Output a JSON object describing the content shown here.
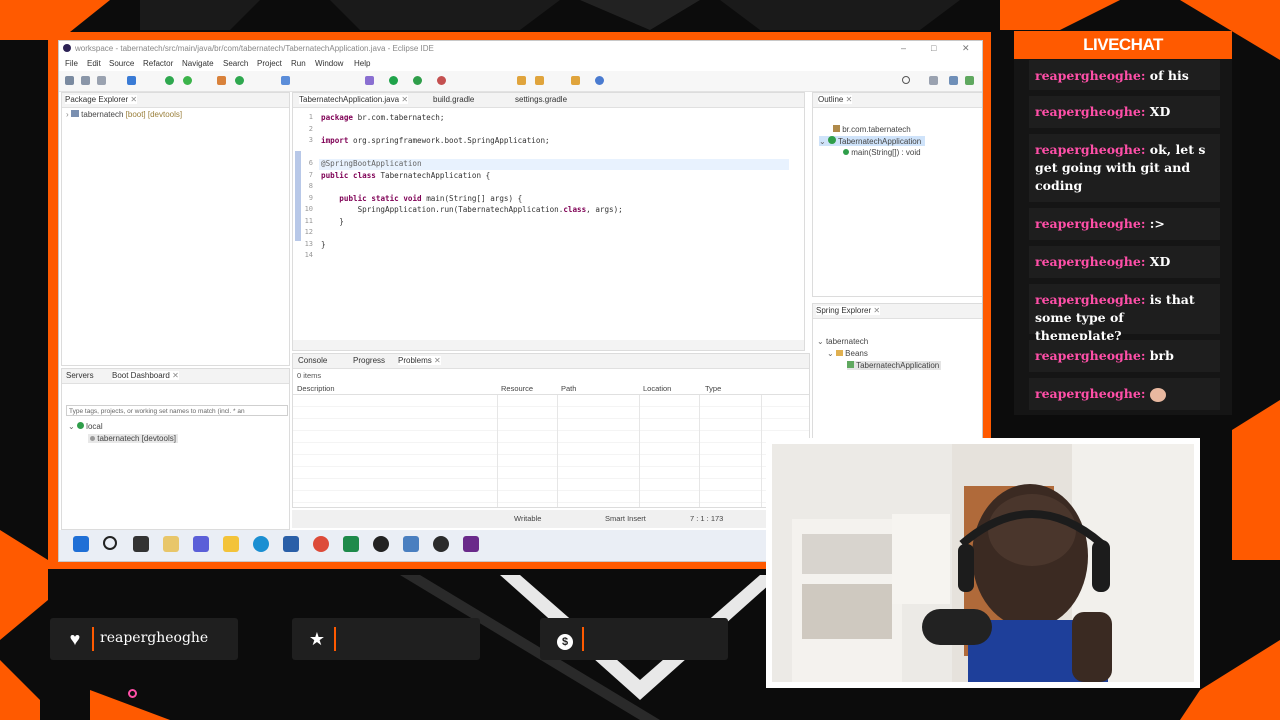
{
  "eclipse": {
    "window_title": "workspace - tabernatech/src/main/java/br/com/tabernatech/TabernatechApplication.java - Eclipse IDE",
    "menu": [
      "File",
      "Edit",
      "Source",
      "Refactor",
      "Navigate",
      "Search",
      "Project",
      "Run",
      "Window",
      "Help"
    ],
    "package_explorer": {
      "tab": "Package Explorer",
      "project": "tabernatech",
      "project_suffix": "[boot] [devtools]"
    },
    "editor": {
      "tabs": [
        "TabernatechApplication.java",
        "build.gradle",
        "settings.gradle"
      ],
      "line_numbers": [
        "1",
        "2",
        "3",
        "",
        "6",
        "7",
        "8",
        "9",
        "10",
        "11",
        "12",
        "13",
        "14"
      ],
      "lines": [
        "package br.com.tabernatech;",
        "",
        "import org.springframework.boot.SpringApplication;",
        "",
        "@SpringBootApplication",
        "public class TabernatechApplication {",
        "",
        "    public static void main(String[] args) {",
        "        SpringApplication.run(TabernatechApplication.class, args);",
        "    }",
        "",
        "}",
        ""
      ]
    },
    "outline": {
      "tab": "Outline",
      "items": [
        "br.com.tabernatech",
        "TabernatechApplication",
        "main(String[]) : void"
      ]
    },
    "spring_explorer": {
      "tab": "Spring Explorer",
      "items": [
        "tabernatech",
        "Beans",
        "TabernatechApplication"
      ]
    },
    "boot_dashboard": {
      "tabs": [
        "Servers",
        "Boot Dashboard"
      ],
      "filter_placeholder": "Type tags, projects, or working set names to match (incl. * an",
      "items": [
        "local",
        "tabernatech [devtools]"
      ]
    },
    "problems": {
      "tabs": [
        "Console",
        "Progress",
        "Problems"
      ],
      "count": "0 items",
      "columns": [
        "Description",
        "Resource",
        "Path",
        "Location",
        "Type"
      ]
    },
    "status": {
      "mode": "Writable",
      "insert": "Smart Insert",
      "position": "7 : 1 : 173"
    }
  },
  "chat": {
    "title": "LIVECHAT",
    "messages": [
      {
        "user": "reapergheoghe",
        "text": "of his"
      },
      {
        "user": "reapergheoghe",
        "text": "XD"
      },
      {
        "user": "reapergheoghe",
        "text": "ok, let s get going with git and coding"
      },
      {
        "user": "reapergheoghe",
        "text": ":>"
      },
      {
        "user": "reapergheoghe",
        "text": "XD"
      },
      {
        "user": "reapergheoghe",
        "text": "is that some type of themeplate?"
      },
      {
        "user": "reapergheoghe",
        "text": "brb"
      },
      {
        "user": "reapergheoghe",
        "text": ""
      }
    ]
  },
  "widgets": {
    "follower": "reapergheoghe",
    "subscriber": "",
    "donation": ""
  },
  "colors": {
    "accent": "#ff5a00",
    "chat_user": "#ff4fa8"
  }
}
